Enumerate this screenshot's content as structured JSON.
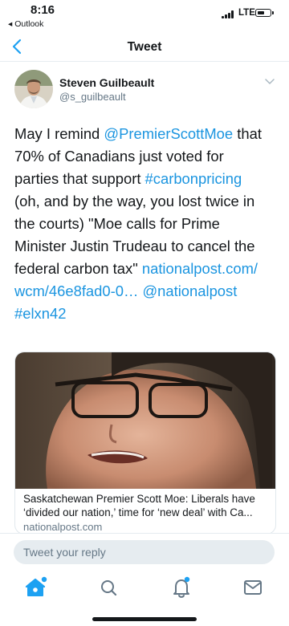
{
  "status_bar": {
    "time": "8:16",
    "back_app": "◂ Outlook",
    "carrier": "LTE"
  },
  "nav": {
    "title": "Tweet",
    "back_icon": "chevron-left-icon"
  },
  "tweet": {
    "author_name": "Steven Guilbeault",
    "author_handle": "@s_guilbeault",
    "lines": [
      [
        {
          "t": "May I remind ",
          "link": false
        },
        {
          "t": "@PremierScottMoe",
          "link": true
        },
        {
          "t": " that",
          "link": false
        }
      ],
      [
        {
          "t": "70% of Canadians just voted for",
          "link": false
        }
      ],
      [
        {
          "t": "parties that support ",
          "link": false
        },
        {
          "t": "#carbonpricing",
          "link": true
        }
      ],
      [
        {
          "t": "(oh, and by the way, you lost twice in",
          "link": false
        }
      ],
      [
        {
          "t": "the courts) \"Moe calls for Prime",
          "link": false
        }
      ],
      [
        {
          "t": "Minister Justin Trudeau to cancel the",
          "link": false
        }
      ],
      [
        {
          "t": "federal carbon tax\" ",
          "link": false
        },
        {
          "t": "nationalpost.com/",
          "link": true
        }
      ],
      [
        {
          "t": "wcm/46e8fad0-0…",
          "link": true
        },
        {
          "t": " ",
          "link": false
        },
        {
          "t": "@nationalpost",
          "link": true
        }
      ],
      [
        {
          "t": "#elxn42",
          "link": true
        }
      ]
    ]
  },
  "card": {
    "title_line1": "Saskatchewan Premier Scott Moe: Liberals have",
    "title_line2": "‘divided our nation,’ time for ‘new deal’ with Ca...",
    "domain": "nationalpost.com"
  },
  "reply": {
    "placeholder": "Tweet your reply"
  },
  "tabs": [
    {
      "name": "tab-home",
      "icon": "home-icon",
      "active": true
    },
    {
      "name": "tab-search",
      "icon": "search-icon",
      "active": false
    },
    {
      "name": "tab-notifications",
      "icon": "bell-icon",
      "active": false
    },
    {
      "name": "tab-messages",
      "icon": "mail-icon",
      "active": false
    }
  ],
  "colors": {
    "accent": "#1da1f2",
    "link": "#1b95e0",
    "text": "#14171a",
    "secondary": "#657786",
    "divider": "#e6ecf0"
  }
}
